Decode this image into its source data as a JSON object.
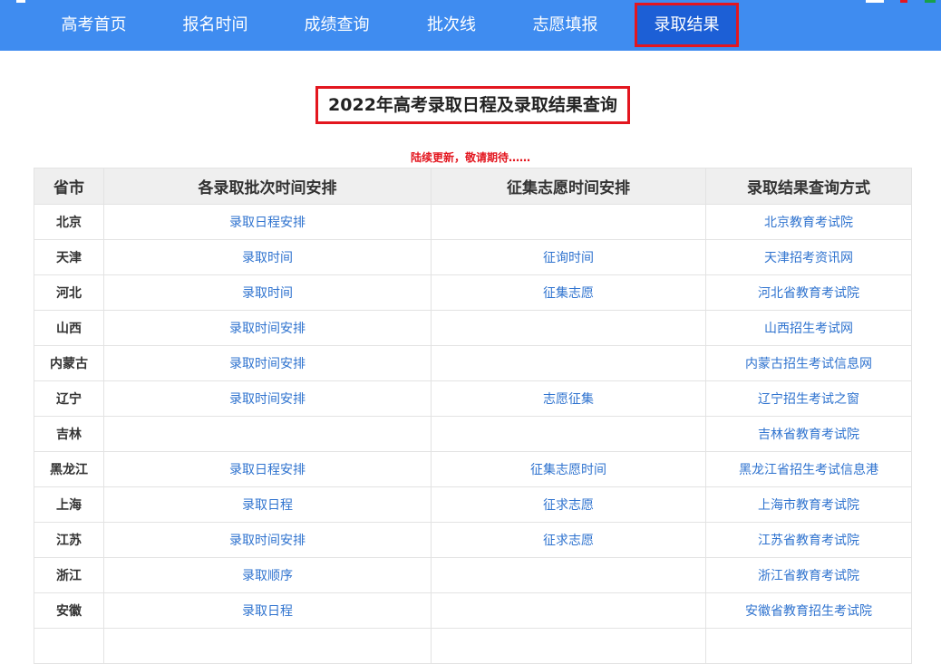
{
  "nav": {
    "items": [
      {
        "label": "高考首页",
        "active": false
      },
      {
        "label": "报名时间",
        "active": false
      },
      {
        "label": "成绩查询",
        "active": false
      },
      {
        "label": "批次线",
        "active": false
      },
      {
        "label": "志愿填报",
        "active": false
      },
      {
        "label": "录取结果",
        "active": true
      }
    ]
  },
  "page": {
    "title": "2022年高考录取日程及录取结果查询",
    "notice": "陆续更新，敬请期待……"
  },
  "table": {
    "headers": [
      "省市",
      "各录取批次时间安排",
      "征集志愿时间安排",
      "录取结果查询方式"
    ],
    "rows": [
      [
        "北京",
        "录取日程安排",
        "",
        "北京教育考试院"
      ],
      [
        "天津",
        "录取时间",
        "征询时间",
        "天津招考资讯网"
      ],
      [
        "河北",
        "录取时间",
        "征集志愿",
        "河北省教育考试院"
      ],
      [
        "山西",
        "录取时间安排",
        "",
        "山西招生考试网"
      ],
      [
        "内蒙古",
        "录取时间安排",
        "",
        "内蒙古招生考试信息网"
      ],
      [
        "辽宁",
        "录取时间安排",
        "志愿征集",
        "辽宁招生考试之窗"
      ],
      [
        "吉林",
        "",
        "",
        "吉林省教育考试院"
      ],
      [
        "黑龙江",
        "录取日程安排",
        "征集志愿时间",
        "黑龙江省招生考试信息港"
      ],
      [
        "上海",
        "录取日程",
        "征求志愿",
        "上海市教育考试院"
      ],
      [
        "江苏",
        "录取时间安排",
        "征求志愿",
        "江苏省教育考试院"
      ],
      [
        "浙江",
        "录取顺序",
        "",
        "浙江省教育考试院"
      ],
      [
        "安徽",
        "录取日程",
        "",
        "安徽省教育招生考试院"
      ],
      [
        "",
        "",
        "",
        ""
      ]
    ]
  },
  "colors": {
    "nav_bg": "#3f8cf0",
    "nav_active_bg": "#1c5fd6",
    "highlight_border": "#e3161f",
    "link": "#2f73cf",
    "notice": "#e3161f"
  }
}
